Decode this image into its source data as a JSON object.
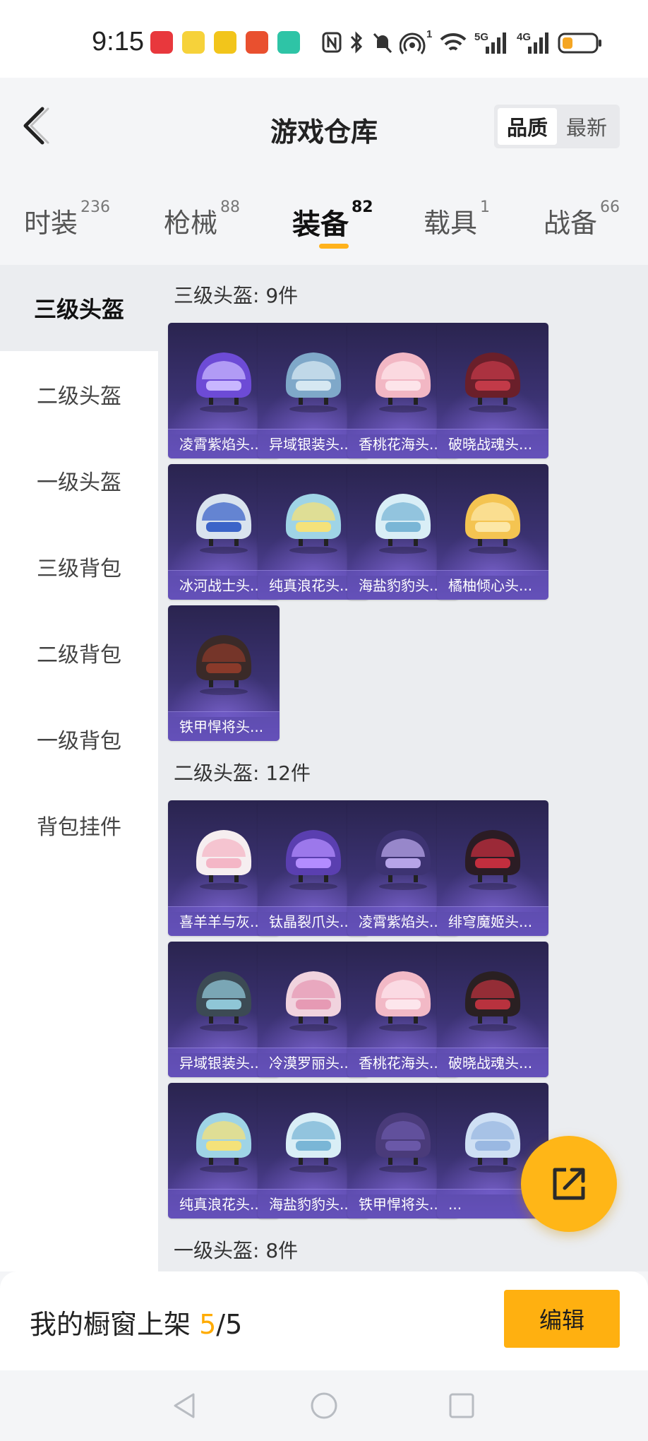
{
  "status_bar": {
    "time": "9:15",
    "network_1": "5G",
    "network_2": "4G",
    "hotspot_count": "1"
  },
  "header": {
    "title": "游戏仓库",
    "sort_options": [
      "品质",
      "最新"
    ],
    "sort_active": "品质"
  },
  "category_tabs": [
    {
      "name": "时装",
      "count": "236"
    },
    {
      "name": "枪械",
      "count": "88"
    },
    {
      "name": "装备",
      "count": "82"
    },
    {
      "name": "载具",
      "count": "1"
    },
    {
      "name": "战备",
      "count": "66"
    }
  ],
  "sidebar": {
    "items": [
      "三级头盔",
      "二级头盔",
      "一级头盔",
      "三级背包",
      "二级背包",
      "一级背包",
      "背包挂件"
    ]
  },
  "sections": [
    {
      "title": "三级头盔: 9件",
      "items": [
        "凌霄紫焰头...",
        "异域银装头...",
        "香桃花海头...",
        "破晓战魂头...",
        "冰河战士头...",
        "纯真浪花头...",
        "海盐豹豹头...",
        "橘柚倾心头...",
        "铁甲悍将头..."
      ]
    },
    {
      "title": "二级头盔: 12件",
      "items": [
        "喜羊羊与灰...",
        "钛晶裂爪头...",
        "凌霄紫焰头...",
        "绯穹魔姬头...",
        "异域银装头...",
        "冷漠罗丽头...",
        "香桃花海头...",
        "破晓战魂头...",
        "纯真浪花头...",
        "海盐豹豹头...",
        "铁甲悍将头...",
        "..."
      ]
    },
    {
      "title": "一级头盔: 8件"
    }
  ],
  "bottom_bar": {
    "shelf_label": "我的橱窗上架",
    "shelf_current": "5",
    "shelf_total": "/5",
    "edit_button": "编辑"
  },
  "colors": {
    "accent": "#ffb21c",
    "card_dark": "#2a244f",
    "card_light": "#5a47a8"
  },
  "icons": [
    "back-arrow-icon",
    "share-external-icon",
    "nav-back-icon",
    "nav-home-icon",
    "nav-recents-icon"
  ]
}
